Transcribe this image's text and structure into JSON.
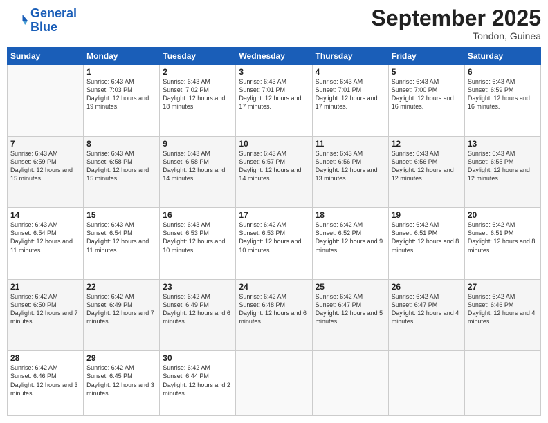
{
  "header": {
    "logo_line1": "General",
    "logo_line2": "Blue",
    "month": "September 2025",
    "location": "Tondon, Guinea"
  },
  "days_of_week": [
    "Sunday",
    "Monday",
    "Tuesday",
    "Wednesday",
    "Thursday",
    "Friday",
    "Saturday"
  ],
  "weeks": [
    [
      {
        "day": "",
        "sunrise": "",
        "sunset": "",
        "daylight": ""
      },
      {
        "day": "1",
        "sunrise": "Sunrise: 6:43 AM",
        "sunset": "Sunset: 7:03 PM",
        "daylight": "Daylight: 12 hours and 19 minutes."
      },
      {
        "day": "2",
        "sunrise": "Sunrise: 6:43 AM",
        "sunset": "Sunset: 7:02 PM",
        "daylight": "Daylight: 12 hours and 18 minutes."
      },
      {
        "day": "3",
        "sunrise": "Sunrise: 6:43 AM",
        "sunset": "Sunset: 7:01 PM",
        "daylight": "Daylight: 12 hours and 17 minutes."
      },
      {
        "day": "4",
        "sunrise": "Sunrise: 6:43 AM",
        "sunset": "Sunset: 7:01 PM",
        "daylight": "Daylight: 12 hours and 17 minutes."
      },
      {
        "day": "5",
        "sunrise": "Sunrise: 6:43 AM",
        "sunset": "Sunset: 7:00 PM",
        "daylight": "Daylight: 12 hours and 16 minutes."
      },
      {
        "day": "6",
        "sunrise": "Sunrise: 6:43 AM",
        "sunset": "Sunset: 6:59 PM",
        "daylight": "Daylight: 12 hours and 16 minutes."
      }
    ],
    [
      {
        "day": "7",
        "sunrise": "Sunrise: 6:43 AM",
        "sunset": "Sunset: 6:59 PM",
        "daylight": "Daylight: 12 hours and 15 minutes."
      },
      {
        "day": "8",
        "sunrise": "Sunrise: 6:43 AM",
        "sunset": "Sunset: 6:58 PM",
        "daylight": "Daylight: 12 hours and 15 minutes."
      },
      {
        "day": "9",
        "sunrise": "Sunrise: 6:43 AM",
        "sunset": "Sunset: 6:58 PM",
        "daylight": "Daylight: 12 hours and 14 minutes."
      },
      {
        "day": "10",
        "sunrise": "Sunrise: 6:43 AM",
        "sunset": "Sunset: 6:57 PM",
        "daylight": "Daylight: 12 hours and 14 minutes."
      },
      {
        "day": "11",
        "sunrise": "Sunrise: 6:43 AM",
        "sunset": "Sunset: 6:56 PM",
        "daylight": "Daylight: 12 hours and 13 minutes."
      },
      {
        "day": "12",
        "sunrise": "Sunrise: 6:43 AM",
        "sunset": "Sunset: 6:56 PM",
        "daylight": "Daylight: 12 hours and 12 minutes."
      },
      {
        "day": "13",
        "sunrise": "Sunrise: 6:43 AM",
        "sunset": "Sunset: 6:55 PM",
        "daylight": "Daylight: 12 hours and 12 minutes."
      }
    ],
    [
      {
        "day": "14",
        "sunrise": "Sunrise: 6:43 AM",
        "sunset": "Sunset: 6:54 PM",
        "daylight": "Daylight: 12 hours and 11 minutes."
      },
      {
        "day": "15",
        "sunrise": "Sunrise: 6:43 AM",
        "sunset": "Sunset: 6:54 PM",
        "daylight": "Daylight: 12 hours and 11 minutes."
      },
      {
        "day": "16",
        "sunrise": "Sunrise: 6:43 AM",
        "sunset": "Sunset: 6:53 PM",
        "daylight": "Daylight: 12 hours and 10 minutes."
      },
      {
        "day": "17",
        "sunrise": "Sunrise: 6:42 AM",
        "sunset": "Sunset: 6:53 PM",
        "daylight": "Daylight: 12 hours and 10 minutes."
      },
      {
        "day": "18",
        "sunrise": "Sunrise: 6:42 AM",
        "sunset": "Sunset: 6:52 PM",
        "daylight": "Daylight: 12 hours and 9 minutes."
      },
      {
        "day": "19",
        "sunrise": "Sunrise: 6:42 AM",
        "sunset": "Sunset: 6:51 PM",
        "daylight": "Daylight: 12 hours and 8 minutes."
      },
      {
        "day": "20",
        "sunrise": "Sunrise: 6:42 AM",
        "sunset": "Sunset: 6:51 PM",
        "daylight": "Daylight: 12 hours and 8 minutes."
      }
    ],
    [
      {
        "day": "21",
        "sunrise": "Sunrise: 6:42 AM",
        "sunset": "Sunset: 6:50 PM",
        "daylight": "Daylight: 12 hours and 7 minutes."
      },
      {
        "day": "22",
        "sunrise": "Sunrise: 6:42 AM",
        "sunset": "Sunset: 6:49 PM",
        "daylight": "Daylight: 12 hours and 7 minutes."
      },
      {
        "day": "23",
        "sunrise": "Sunrise: 6:42 AM",
        "sunset": "Sunset: 6:49 PM",
        "daylight": "Daylight: 12 hours and 6 minutes."
      },
      {
        "day": "24",
        "sunrise": "Sunrise: 6:42 AM",
        "sunset": "Sunset: 6:48 PM",
        "daylight": "Daylight: 12 hours and 6 minutes."
      },
      {
        "day": "25",
        "sunrise": "Sunrise: 6:42 AM",
        "sunset": "Sunset: 6:47 PM",
        "daylight": "Daylight: 12 hours and 5 minutes."
      },
      {
        "day": "26",
        "sunrise": "Sunrise: 6:42 AM",
        "sunset": "Sunset: 6:47 PM",
        "daylight": "Daylight: 12 hours and 4 minutes."
      },
      {
        "day": "27",
        "sunrise": "Sunrise: 6:42 AM",
        "sunset": "Sunset: 6:46 PM",
        "daylight": "Daylight: 12 hours and 4 minutes."
      }
    ],
    [
      {
        "day": "28",
        "sunrise": "Sunrise: 6:42 AM",
        "sunset": "Sunset: 6:46 PM",
        "daylight": "Daylight: 12 hours and 3 minutes."
      },
      {
        "day": "29",
        "sunrise": "Sunrise: 6:42 AM",
        "sunset": "Sunset: 6:45 PM",
        "daylight": "Daylight: 12 hours and 3 minutes."
      },
      {
        "day": "30",
        "sunrise": "Sunrise: 6:42 AM",
        "sunset": "Sunset: 6:44 PM",
        "daylight": "Daylight: 12 hours and 2 minutes."
      },
      {
        "day": "",
        "sunrise": "",
        "sunset": "",
        "daylight": ""
      },
      {
        "day": "",
        "sunrise": "",
        "sunset": "",
        "daylight": ""
      },
      {
        "day": "",
        "sunrise": "",
        "sunset": "",
        "daylight": ""
      },
      {
        "day": "",
        "sunrise": "",
        "sunset": "",
        "daylight": ""
      }
    ]
  ]
}
